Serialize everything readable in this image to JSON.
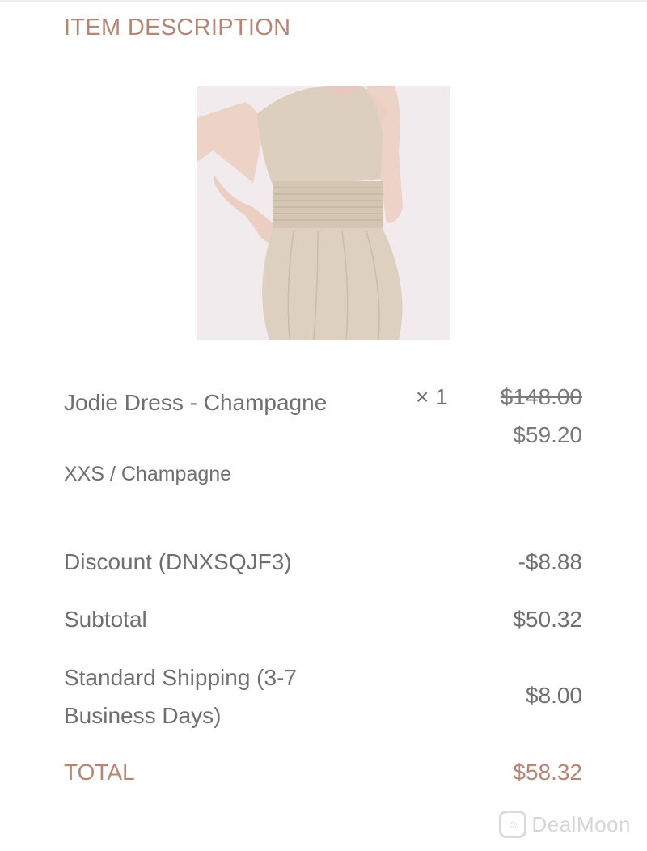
{
  "section": {
    "title": "ITEM DESCRIPTION"
  },
  "item": {
    "name": "Jodie Dress - Champagne",
    "variant": "XXS / Champagne",
    "quantity": "× 1",
    "original_price": "$148.00",
    "sale_price": "$59.20",
    "image_alt": "Champagne halter dress with smocked waist"
  },
  "summary": {
    "discount_label": "Discount (DNXSQJF3)",
    "discount_value": "-$8.88",
    "subtotal_label": "Subtotal",
    "subtotal_value": "$50.32",
    "shipping_label": "Standard Shipping (3-7 Business Days)",
    "shipping_value": "$8.00",
    "total_label": "TOTAL",
    "total_value": "$58.32"
  },
  "watermark": {
    "text": "DealMoon"
  },
  "colors": {
    "accent": "#b58575",
    "text": "#6f6f6f",
    "image_bg": "#f2ebee",
    "dress": "#dccfbd"
  }
}
